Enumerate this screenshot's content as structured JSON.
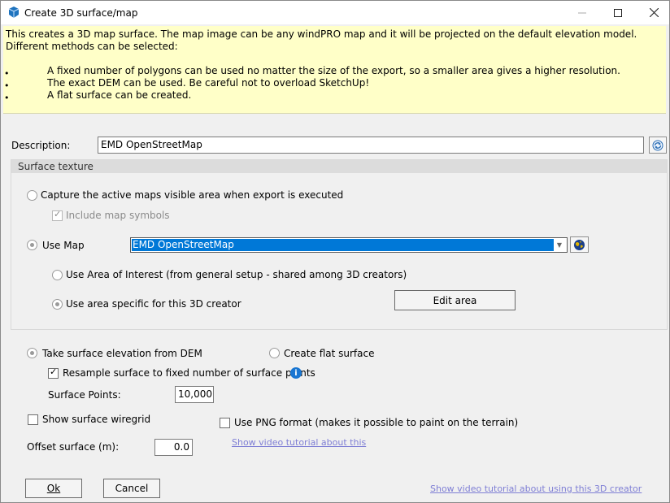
{
  "window": {
    "title": "Create 3D surface/map",
    "min_icon": "minimize-icon",
    "max_icon": "maximize-icon",
    "close_icon": "close-icon"
  },
  "info": {
    "intro": "This creates a 3D map surface. The map image can be any windPRO map and it will be projected on the default elevation model. Different methods can be selected:",
    "bullets": [
      "A fixed number of polygons can be used no matter the size of the export, so a smaller area gives a higher resolution.",
      "The exact DEM can be used. Be careful not to overload SketchUp!",
      "A flat surface can be created."
    ]
  },
  "description": {
    "label": "Description:",
    "value": "EMD OpenStreetMap"
  },
  "surface_texture": {
    "title": "Surface texture",
    "capture_label": "Capture the active maps visible area when export is executed",
    "include_symbols_label": "Include map symbols",
    "use_map_label": "Use Map",
    "map_selected": "EMD OpenStreetMap",
    "area_of_interest_label": "Use Area of Interest (from general setup - shared among 3D creators)",
    "area_specific_label": "Use area specific for this 3D creator",
    "edit_area_label": "Edit area"
  },
  "elevation": {
    "from_dem_label": "Take surface elevation from DEM",
    "flat_label": "Create flat surface",
    "resample_label": "Resample surface to fixed number of surface points",
    "info_glyph": "i",
    "surface_points_label": "Surface Points:",
    "surface_points_value": "10,000"
  },
  "options": {
    "wiregrid_label": "Show surface wiregrid",
    "png_label": "Use PNG format (makes it possible to paint on the terrain)",
    "offset_label": "Offset surface (m):",
    "offset_value": "0.0",
    "video_link_small": "Show video tutorial about this"
  },
  "footer": {
    "ok_label": "Ok",
    "cancel_label": "Cancel",
    "video_link": "Show video tutorial about using this 3D creator"
  },
  "colors": {
    "info_bg": "#ffffc8",
    "selection": "#0078d7",
    "link": "#7f7fd5"
  }
}
